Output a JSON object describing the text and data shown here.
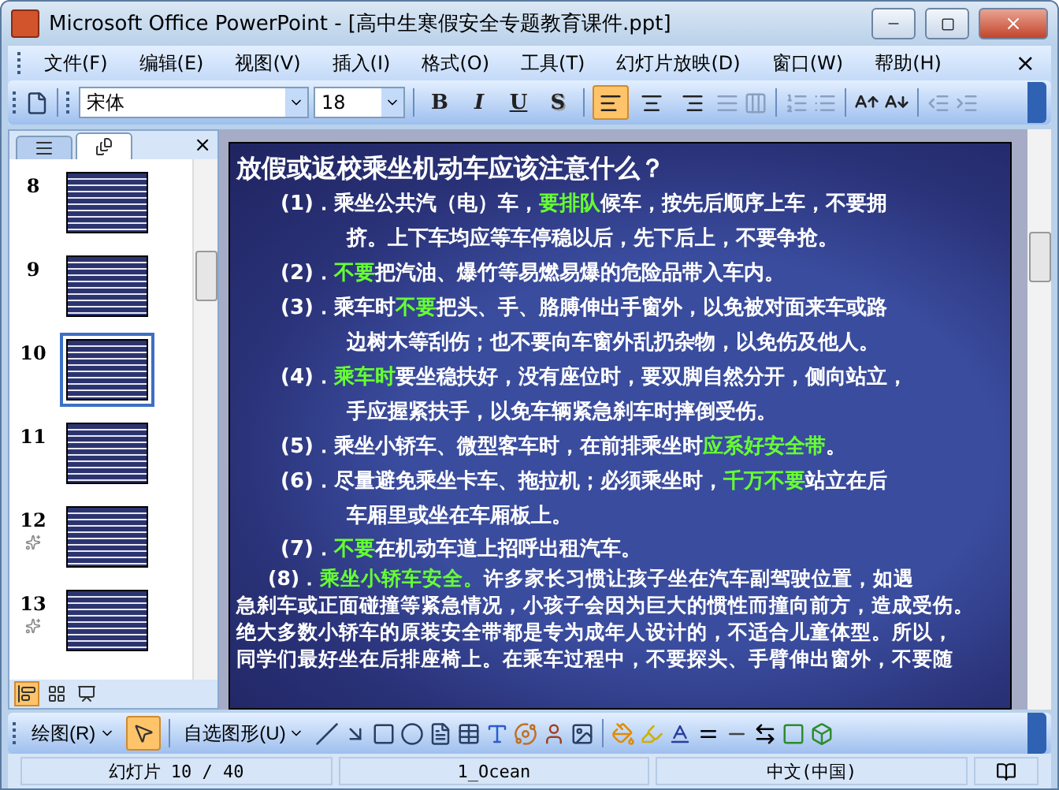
{
  "window": {
    "title": "Microsoft Office PowerPoint - [高中生寒假安全专题教育课件.ppt]"
  },
  "menu": {
    "items": [
      "文件(F)",
      "编辑(E)",
      "视图(V)",
      "插入(I)",
      "格式(O)",
      "工具(T)",
      "幻灯片放映(D)",
      "窗口(W)",
      "帮助(H)"
    ],
    "close": "×"
  },
  "format_toolbar": {
    "font": "宋体",
    "size": "18",
    "styles": [
      "B",
      "I",
      "U",
      "S"
    ],
    "alignment": [
      {
        "kind": "left",
        "selected": true
      },
      {
        "kind": "center",
        "selected": false
      },
      {
        "kind": "right",
        "selected": false
      }
    ]
  },
  "slides_panel": {
    "close": "×",
    "tabs": [
      {
        "kind": "outline",
        "selected": false
      },
      {
        "kind": "slides",
        "selected": true
      }
    ],
    "slides": [
      {
        "number": "8",
        "animated": false,
        "selected": false
      },
      {
        "number": "9",
        "animated": false,
        "selected": false
      },
      {
        "number": "10",
        "animated": false,
        "selected": true
      },
      {
        "number": "11",
        "animated": false,
        "selected": false
      },
      {
        "number": "12",
        "animated": true,
        "selected": false
      },
      {
        "number": "13",
        "animated": true,
        "selected": false
      }
    ],
    "views": [
      {
        "kind": "normal",
        "selected": true
      },
      {
        "kind": "sorter",
        "selected": false
      },
      {
        "kind": "show",
        "selected": false
      }
    ]
  },
  "slide": {
    "title": "放假或返校乘坐机动车应该注意什么？",
    "paragraphs": [
      {
        "kind": "item",
        "lines": [
          [
            {
              "text": "(1)．乘坐公共汽（电）车，",
              "highlight": false
            },
            {
              "text": "要排队",
              "highlight": true
            },
            {
              "text": "候车，按先后顺序上车，不要拥",
              "highlight": false
            }
          ],
          [
            {
              "text": "挤。上下车均应等车停稳以后，先下后上，不要争抢。",
              "highlight": false
            }
          ]
        ]
      },
      {
        "kind": "item",
        "lines": [
          [
            {
              "text": "(2)．",
              "highlight": false
            },
            {
              "text": "不要",
              "highlight": true
            },
            {
              "text": "把汽油、爆竹等易燃易爆的危险品带入车内。",
              "highlight": false
            }
          ]
        ]
      },
      {
        "kind": "item",
        "lines": [
          [
            {
              "text": "(3)．乘车时",
              "highlight": false
            },
            {
              "text": "不要",
              "highlight": true
            },
            {
              "text": "把头、手、胳膊伸出手窗外，以免被对面来车或路",
              "highlight": false
            }
          ],
          [
            {
              "text": "边树木等刮伤；也不要向车窗外乱扔杂物，以免伤及他人。",
              "highlight": false
            }
          ]
        ]
      },
      {
        "kind": "item",
        "lines": [
          [
            {
              "text": "(4)．",
              "highlight": false
            },
            {
              "text": "乘车时",
              "highlight": true
            },
            {
              "text": "要坐稳扶好，没有座位时，要双脚自然分开，侧向站立，",
              "highlight": false
            }
          ],
          [
            {
              "text": "手应握紧扶手，以免车辆紧急刹车时摔倒受伤。",
              "highlight": false
            }
          ]
        ]
      },
      {
        "kind": "item",
        "lines": [
          [
            {
              "text": "(5)．乘坐小轿车、微型客车时，在前排乘坐时",
              "highlight": false
            },
            {
              "text": "应系好安全带",
              "highlight": true
            },
            {
              "text": "。",
              "highlight": false
            }
          ]
        ]
      },
      {
        "kind": "item",
        "lines": [
          [
            {
              "text": "(6)．尽量避免乘坐卡车、拖拉机；必须乘坐时，",
              "highlight": false
            },
            {
              "text": "千万不要",
              "highlight": true
            },
            {
              "text": "站立在后",
              "highlight": false
            }
          ],
          [
            {
              "text": "车厢里或坐在车厢板上。",
              "highlight": false
            }
          ]
        ]
      },
      {
        "kind": "tight",
        "lines": [
          [
            {
              "text": "(7)．",
              "highlight": false
            },
            {
              "text": "不要",
              "highlight": true
            },
            {
              "text": "在机动车道上招呼出租汽车。",
              "highlight": false
            }
          ]
        ]
      },
      {
        "kind": "prose",
        "lines": [
          [
            {
              "text": "(8)．",
              "highlight": false
            },
            {
              "text": "乘坐小轿车安全。",
              "highlight": true
            },
            {
              "text": "许多家长习惯让孩子坐在汽车副驾驶位置，如遇",
              "highlight": false
            }
          ],
          [
            {
              "text": "急刹车或正面碰撞等紧急情况，小孩子会因为巨大的惯性而撞向前方，造成受伤。",
              "highlight": false
            }
          ],
          [
            {
              "text": "绝大多数小轿车的原装安全带都是专为成年人设计的，不适合儿童体型。所以，",
              "highlight": false
            }
          ],
          [
            {
              "text": "同学们最好坐在后排座椅上。在乘车过程中，不要探头、手臂伸出窗外，不要随",
              "highlight": false
            }
          ]
        ]
      }
    ]
  },
  "drawing_toolbar": {
    "draw": "绘图(R)",
    "autoshapes": "自选图形(U)"
  },
  "status_bar": {
    "slide": "幻灯片 10 / 40",
    "design": "1_Ocean",
    "language": "中文(中国)"
  }
}
